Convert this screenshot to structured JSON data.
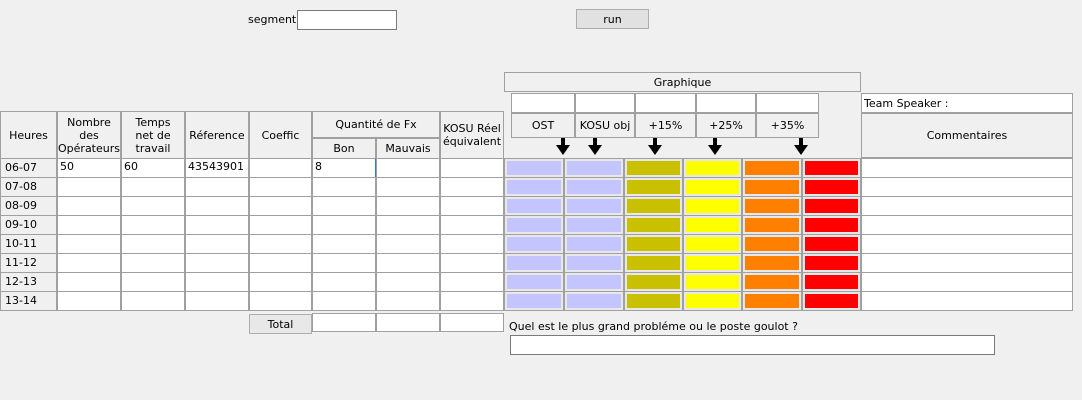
{
  "top": {
    "segment_label": "segment :",
    "segment_value": "",
    "run_label": "run"
  },
  "graphique": {
    "title": "Graphique",
    "levels": [
      "OST",
      "KOSU obj",
      "+15%",
      "+25%",
      "+35%"
    ],
    "colors": [
      "#c4c4ff",
      "#c4c4ff",
      "#c8c000",
      "#ffff00",
      "#ff8000",
      "#ff0000"
    ]
  },
  "team": {
    "label": "Team Speaker :",
    "comments_label": "Commentaires"
  },
  "table": {
    "headers": {
      "heures": "Heures",
      "operateurs": "Nombre des Opérateurs",
      "temps": "Temps net de travail",
      "reference": "Réference",
      "coeffic": "Coeffic",
      "quantite": "Quantité de Fx",
      "bon": "Bon",
      "mauvais": "Mauvais",
      "kosu": "KOSU Réel équivalent"
    },
    "rows": [
      {
        "heure": "06-07",
        "operateurs": "50",
        "temps": "60",
        "reference": "43543901",
        "coeffic": "",
        "bon": "8",
        "mauvais": "",
        "kosu": "",
        "commentaire": ""
      },
      {
        "heure": "07-08",
        "operateurs": "",
        "temps": "",
        "reference": "",
        "coeffic": "",
        "bon": "",
        "mauvais": "",
        "kosu": "",
        "commentaire": ""
      },
      {
        "heure": "08-09",
        "operateurs": "",
        "temps": "",
        "reference": "",
        "coeffic": "",
        "bon": "",
        "mauvais": "",
        "kosu": "",
        "commentaire": ""
      },
      {
        "heure": "09-10",
        "operateurs": "",
        "temps": "",
        "reference": "",
        "coeffic": "",
        "bon": "",
        "mauvais": "",
        "kosu": "",
        "commentaire": ""
      },
      {
        "heure": "10-11",
        "operateurs": "",
        "temps": "",
        "reference": "",
        "coeffic": "",
        "bon": "",
        "mauvais": "",
        "kosu": "",
        "commentaire": ""
      },
      {
        "heure": "11-12",
        "operateurs": "",
        "temps": "",
        "reference": "",
        "coeffic": "",
        "bon": "",
        "mauvais": "",
        "kosu": "",
        "commentaire": ""
      },
      {
        "heure": "12-13",
        "operateurs": "",
        "temps": "",
        "reference": "",
        "coeffic": "",
        "bon": "",
        "mauvais": "",
        "kosu": "",
        "commentaire": ""
      },
      {
        "heure": "13-14",
        "operateurs": "",
        "temps": "",
        "reference": "",
        "coeffic": "",
        "bon": "",
        "mauvais": "",
        "kosu": "",
        "commentaire": ""
      }
    ],
    "total_label": "Total"
  },
  "question": {
    "label": "Quel est le plus grand probléme ou le poste goulot ?",
    "answer": ""
  },
  "icons": {
    "level_pointer": "arrow-down-icon"
  }
}
